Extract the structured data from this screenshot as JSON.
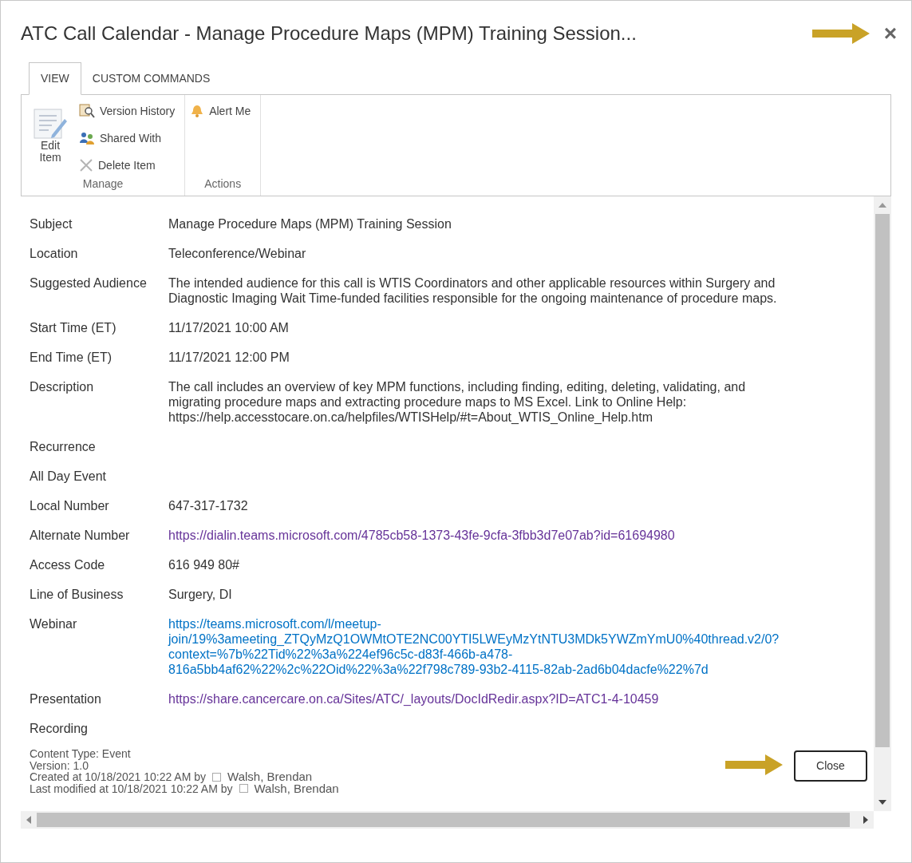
{
  "window": {
    "title": "ATC Call Calendar - Manage Procedure Maps (MPM) Training Session...",
    "close": "×"
  },
  "ribbon": {
    "tabs": [
      {
        "label": "VIEW",
        "selected": true
      },
      {
        "label": "CUSTOM COMMANDS",
        "selected": false
      }
    ],
    "groups": [
      {
        "label": "Manage",
        "large": {
          "label": "Edit Item"
        },
        "items": [
          {
            "label": "Version History"
          },
          {
            "label": "Shared With"
          },
          {
            "label": "Delete Item"
          }
        ]
      },
      {
        "label": "Actions",
        "items": [
          {
            "label": "Alert Me"
          }
        ]
      }
    ]
  },
  "fields": [
    {
      "label": "Subject",
      "kind": "text",
      "lines": [
        "Manage Procedure Maps (MPM) Training Session"
      ]
    },
    {
      "label": "Location",
      "kind": "text",
      "lines": [
        "Teleconference/Webinar"
      ]
    },
    {
      "label": "Suggested Audience",
      "kind": "text",
      "lines": [
        "The intended audience for this call is WTIS Coordinators and other applicable resources within Surgery and",
        "Diagnostic Imaging Wait Time-funded facilities responsible for the ongoing maintenance of procedure maps."
      ]
    },
    {
      "label": "Start Time (ET)",
      "kind": "text",
      "lines": [
        "11/17/2021 10:00 AM"
      ]
    },
    {
      "label": "End Time (ET)",
      "kind": "text",
      "lines": [
        "11/17/2021 12:00 PM"
      ]
    },
    {
      "label": "Description",
      "kind": "text",
      "lines": [
        "The call includes an overview of key MPM functions, including finding, editing, deleting, validating, and",
        "migrating procedure maps and extracting procedure maps to MS Excel. Link to Online Help:",
        "https://help.accesstocare.on.ca/helpfiles/WTISHelp/#t=About_WTIS_Online_Help.htm"
      ]
    },
    {
      "label": "Recurrence"
    },
    {
      "label": "All Day Event"
    },
    {
      "label": "Local Number",
      "kind": "text",
      "lines": [
        "647-317-1732"
      ]
    },
    {
      "label": "Alternate Number",
      "kind": "visited_link",
      "lines": [
        "https://dialin.teams.microsoft.com/4785cb58-1373-43fe-9cfa-3fbb3d7e07ab?id=61694980"
      ]
    },
    {
      "label": "Access Code",
      "kind": "text",
      "lines": [
        "616 949 80#"
      ]
    },
    {
      "label": "Line of Business",
      "kind": "text",
      "lines": [
        "Surgery, DI"
      ]
    },
    {
      "label": "Webinar",
      "kind": "link",
      "lines": [
        "https://teams.microsoft.com/l/meetup-",
        "join/19%3ameeting_ZTQyMzQ1OWMtOTE2NC00YTI5LWEyMzYtNTU3MDk5YWZmYmU0%40thread.v2/0?",
        "context=%7b%22Tid%22%3a%224ef96c5c-d83f-466b-a478-",
        "816a5bb4af62%22%2c%22Oid%22%3a%22f798c789-93b2-4115-82ab-2ad6b04dacfe%22%7d"
      ]
    },
    {
      "label": "Presentation",
      "kind": "visited_link",
      "lines": [
        "https://share.cancercare.on.ca/Sites/ATC/_layouts/DocIdRedir.aspx?ID=ATC1-4-10459"
      ]
    },
    {
      "label": "Recording"
    }
  ],
  "footer": [
    {
      "text": "Content Type: Event"
    },
    {
      "text": "Version: 1.0"
    },
    {
      "text": "Created at 10/18/2021 10:22 AM by",
      "user": "Walsh, Brendan"
    },
    {
      "text": "Last modified at 10/18/2021 10:22 AM by",
      "user": "Walsh, Brendan"
    }
  ],
  "close_button": "Close"
}
